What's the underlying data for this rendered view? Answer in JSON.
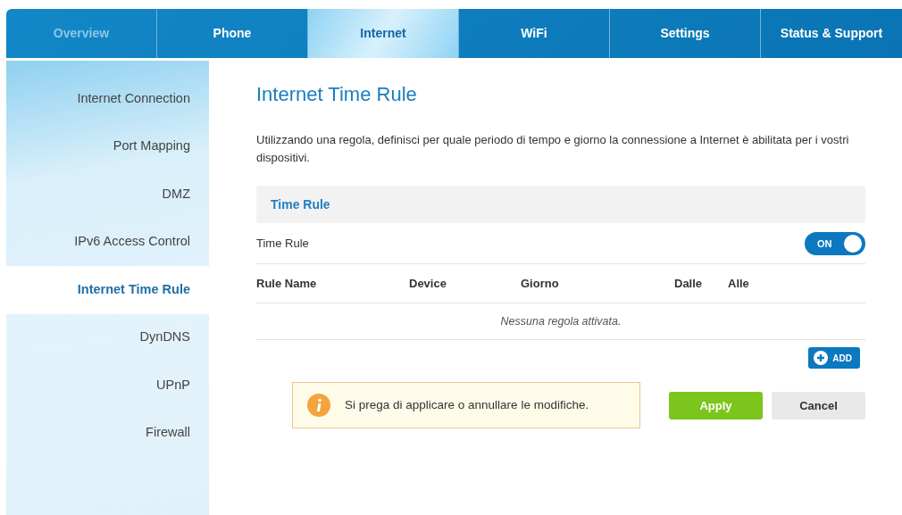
{
  "tabs": [
    {
      "label": "Overview",
      "selected": false,
      "dimmed": true
    },
    {
      "label": "Phone",
      "selected": false,
      "dimmed": false
    },
    {
      "label": "Internet",
      "selected": true,
      "dimmed": false
    },
    {
      "label": "WiFi",
      "selected": false,
      "dimmed": false
    },
    {
      "label": "Settings",
      "selected": false,
      "dimmed": false
    },
    {
      "label": "Status & Support",
      "selected": false,
      "dimmed": false
    }
  ],
  "sidebar": {
    "items": [
      {
        "label": "Internet Connection",
        "selected": false
      },
      {
        "label": "Port Mapping",
        "selected": false
      },
      {
        "label": "DMZ",
        "selected": false
      },
      {
        "label": "IPv6 Access Control",
        "selected": false
      },
      {
        "label": "Internet Time Rule",
        "selected": true
      },
      {
        "label": "DynDNS",
        "selected": false
      },
      {
        "label": "UPnP",
        "selected": false
      },
      {
        "label": "Firewall",
        "selected": false
      }
    ]
  },
  "title": "Internet Time Rule",
  "description": "Utilizzando una regola, definisci per quale periodo di tempo e giorno la connessione a Internet è abilitata per i vostri dispositivi.",
  "section": {
    "heading": "Time Rule"
  },
  "toggle_row": {
    "label": "Time Rule",
    "on": true,
    "toggle_label": "ON"
  },
  "table": {
    "columns": [
      "Rule Name",
      "Device",
      "Giorno",
      "Dalle",
      "Alle"
    ],
    "empty_message": "Nessuna regola attivata."
  },
  "add_button": "ADD",
  "notice": "Si prega di applicare o annullare le modifiche.",
  "buttons": [
    {
      "label": "Apply",
      "kind": "primary"
    },
    {
      "label": "Cancel",
      "kind": "secondary"
    }
  ]
}
